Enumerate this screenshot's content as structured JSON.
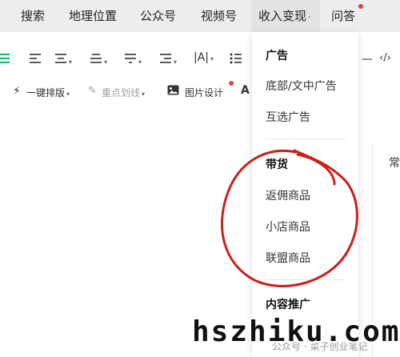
{
  "nav": {
    "items": [
      "搜索",
      "地理位置",
      "公众号",
      "视频号",
      "收入变现",
      "问答"
    ],
    "active_caret": "·"
  },
  "toolbar": {
    "row1_icons": [
      "align-justify-icon",
      "align-left-icon",
      "align-center-icon",
      "line-spacing-icon",
      "paragraph-spacing-icon",
      "indent-icon",
      "letter-spacing-icon",
      "list-icon",
      "code-icon"
    ],
    "typeset_label": "一键排版",
    "highlight_label": "重点划线",
    "image_design_label": "图片设计",
    "partial_label": "A"
  },
  "dropdown": {
    "ads_header": "广告",
    "ads_items": [
      "底部/文中广告",
      "互选广告"
    ],
    "goods_header": "带货",
    "goods_items": [
      "返佣商品",
      "小店商品",
      "联盟商品"
    ],
    "promo_header": "内容推广"
  },
  "side_text": "常",
  "watermark": {
    "text": "hszhiku.com",
    "overlay": "公众号 · 菜子创业笔记"
  },
  "colors": {
    "accent_green": "#07c160",
    "red_dot": "#e8413a",
    "annotation_red": "#cc1f1f"
  }
}
